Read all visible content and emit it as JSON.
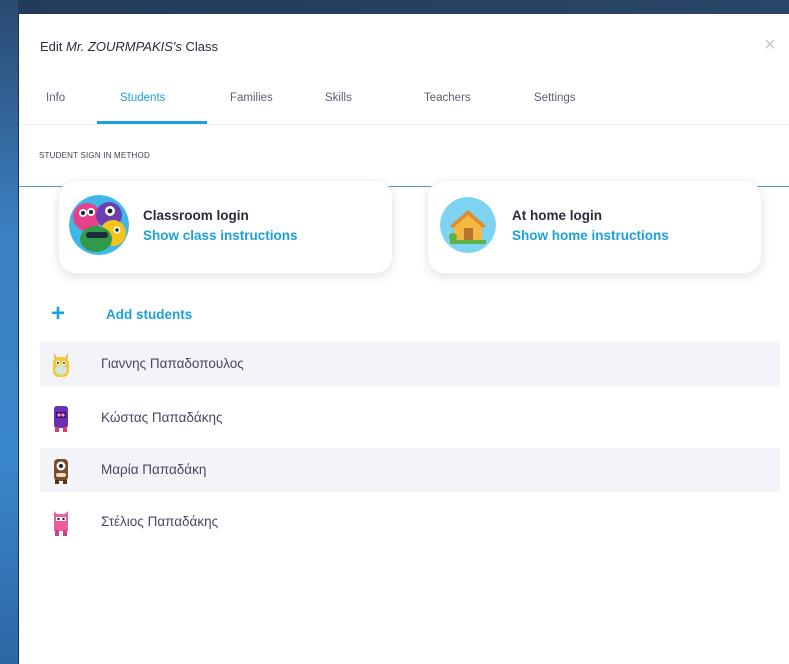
{
  "modal": {
    "title_prefix": "Edit ",
    "title_name": "Mr. ZOURMPAKIS's",
    "title_suffix": " Class",
    "close_icon": "close-icon"
  },
  "tabs": [
    {
      "label": "Info",
      "active": false
    },
    {
      "label": "Students",
      "active": true
    },
    {
      "label": "Families",
      "active": false
    },
    {
      "label": "Skills",
      "active": false
    },
    {
      "label": "Teachers",
      "active": false
    },
    {
      "label": "Settings",
      "active": false
    }
  ],
  "sign_in": {
    "section_label": "STUDENT SIGN IN METHOD",
    "classroom": {
      "title": "Classroom login",
      "link": "Show class instructions",
      "icon": "monsters-icon"
    },
    "home": {
      "title": "At home login",
      "link": "Show home instructions",
      "icon": "house-icon"
    }
  },
  "add_students": {
    "label": "Add students",
    "icon": "plus-icon"
  },
  "students": [
    {
      "name": "Γιαννης Παπαδοπουλος",
      "avatar": "yellow-monster-icon"
    },
    {
      "name": "Κώστας Παπαδάκης",
      "avatar": "purple-monster-icon"
    },
    {
      "name": "Μαρία Παπαδάκη",
      "avatar": "brown-cyclops-monster-icon"
    },
    {
      "name": "Στέλιος Παπαδάκης",
      "avatar": "pink-monster-icon"
    }
  ],
  "colors": {
    "accent": "#1ca1dc",
    "text": "#2b2b3c",
    "row_shade": "#f3f4fa"
  }
}
